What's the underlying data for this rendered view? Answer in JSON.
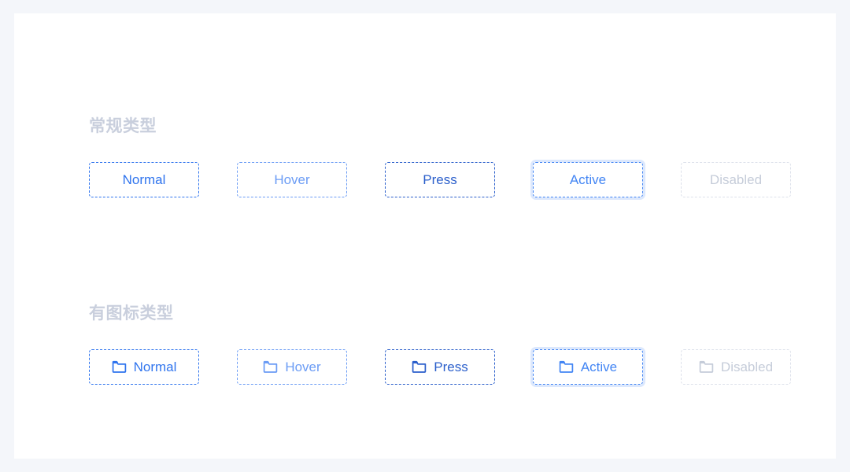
{
  "page": {
    "background_color": "#f4f6fa",
    "card_background_color": "#ffffff"
  },
  "sections": [
    {
      "id": "normal-type",
      "title": "常规类型",
      "title_color": "#c9cfdd",
      "buttons": [
        {
          "state": "normal",
          "label": "Normal",
          "color": "#2f74ee",
          "border_color": "#2f74ee",
          "has_icon": false
        },
        {
          "state": "hover",
          "label": "Hover",
          "color": "#6b9cf5",
          "border_color": "#6b9cf5",
          "has_icon": false
        },
        {
          "state": "press",
          "label": "Press",
          "color": "#2b5fcb",
          "border_color": "#2b5fcb",
          "has_icon": false
        },
        {
          "state": "active",
          "label": "Active",
          "color": "#4285f4",
          "border_color": "#4285f4",
          "has_icon": false,
          "focus_ring_color": "#dce8fd"
        },
        {
          "state": "disabled",
          "label": "Disabled",
          "color": "#c5ccd9",
          "border_color": "#dde1eb",
          "has_icon": false
        }
      ]
    },
    {
      "id": "icon-type",
      "title": "有图标类型",
      "title_color": "#c9cfdd",
      "buttons": [
        {
          "state": "normal",
          "label": "Normal",
          "color": "#2f74ee",
          "border_color": "#2f74ee",
          "has_icon": true,
          "icon": "folder-icon"
        },
        {
          "state": "hover",
          "label": "Hover",
          "color": "#6b9cf5",
          "border_color": "#6b9cf5",
          "has_icon": true,
          "icon": "folder-icon"
        },
        {
          "state": "press",
          "label": "Press",
          "color": "#2b5fcb",
          "border_color": "#2b5fcb",
          "has_icon": true,
          "icon": "folder-icon"
        },
        {
          "state": "active",
          "label": "Active",
          "color": "#4285f4",
          "border_color": "#4285f4",
          "has_icon": true,
          "icon": "folder-icon",
          "focus_ring_color": "#dce8fd"
        },
        {
          "state": "disabled",
          "label": "Disabled",
          "color": "#c5ccd9",
          "border_color": "#dde1eb",
          "has_icon": true,
          "icon": "folder-icon"
        }
      ]
    }
  ]
}
